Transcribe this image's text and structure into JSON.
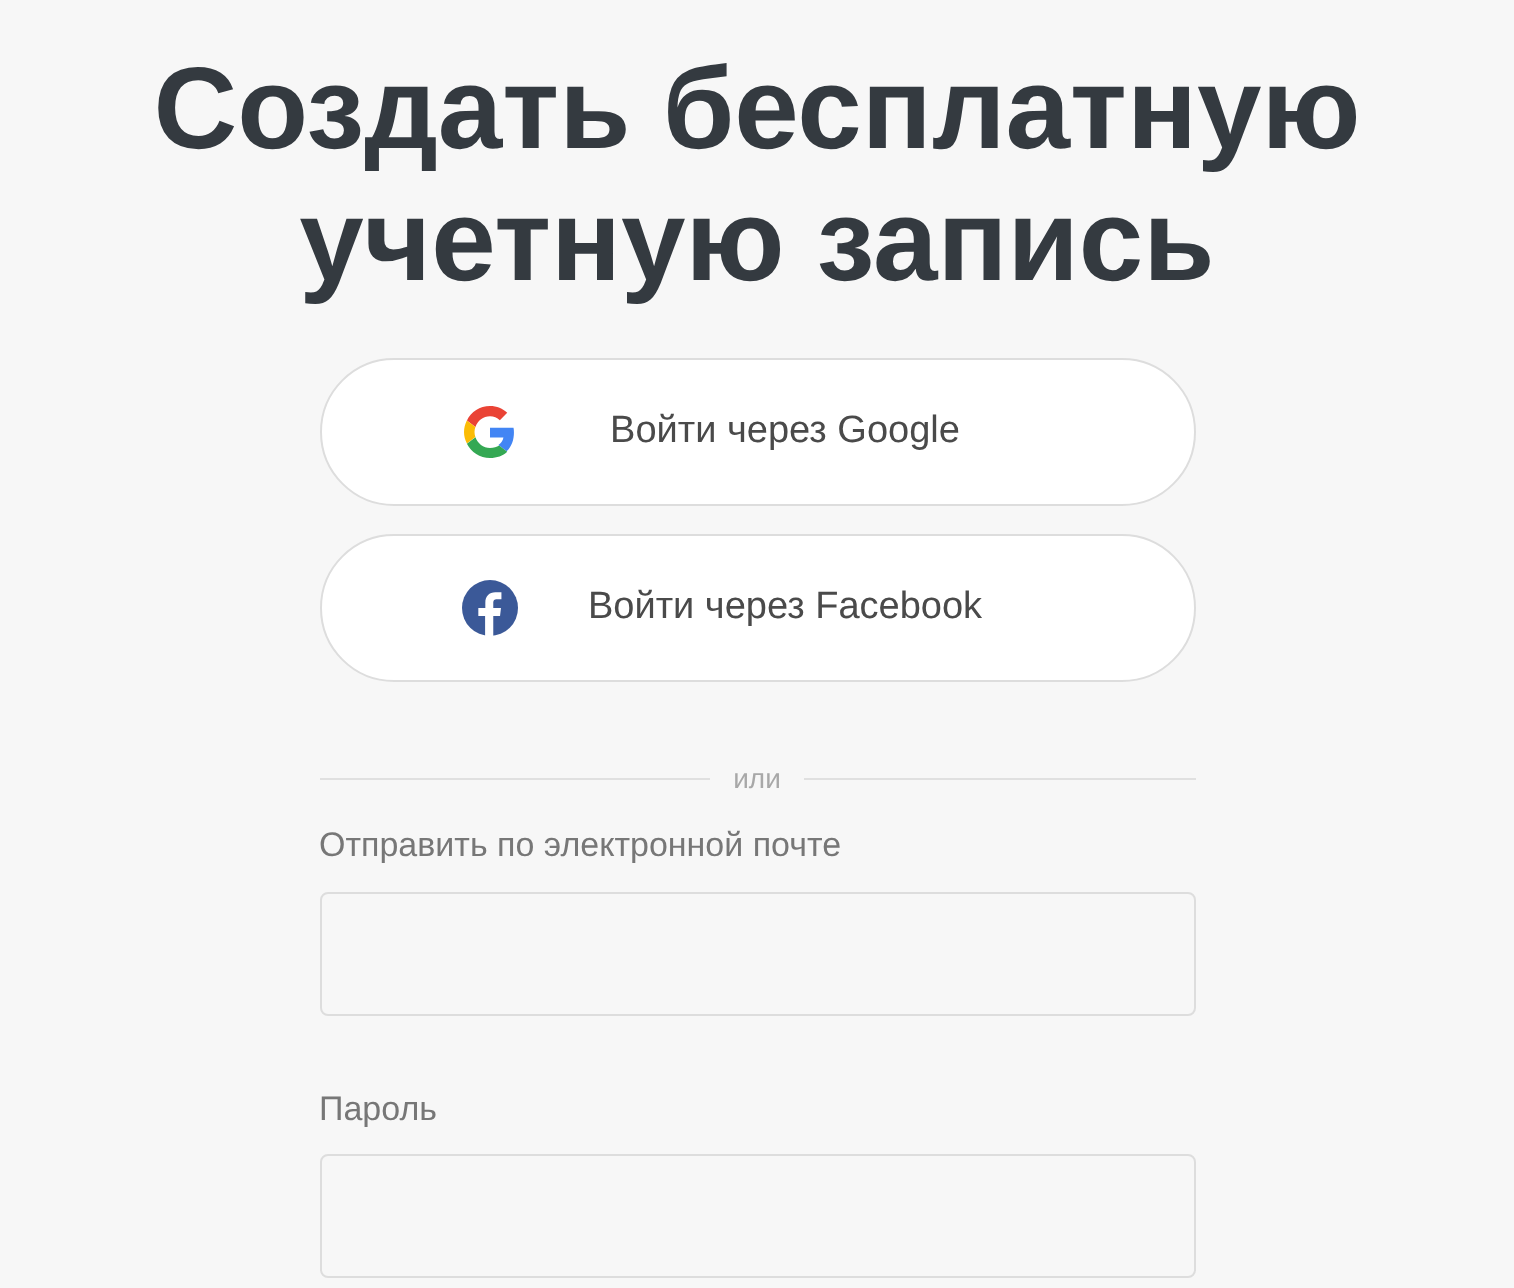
{
  "title": "Создать бесплатную учетную запись",
  "social_buttons": [
    {
      "kind": "google",
      "label": "Войти через Google"
    },
    {
      "kind": "facebook",
      "label": "Войти через Facebook"
    }
  ],
  "divider": "или",
  "fields": [
    {
      "label": "Отправить по электронной почте"
    },
    {
      "label": "Пароль"
    }
  ]
}
